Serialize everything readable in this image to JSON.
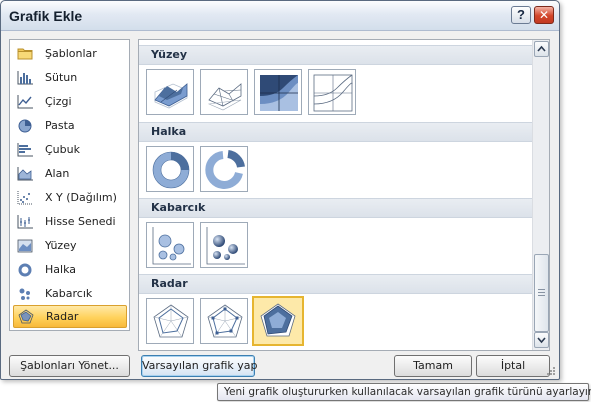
{
  "window": {
    "title": "Grafik Ekle"
  },
  "categories": [
    {
      "label": "Şablonlar",
      "icon": "folder-icon"
    },
    {
      "label": "Sütun",
      "icon": "column-chart-icon"
    },
    {
      "label": "Çizgi",
      "icon": "line-chart-icon"
    },
    {
      "label": "Pasta",
      "icon": "pie-chart-icon"
    },
    {
      "label": "Çubuk",
      "icon": "bar-chart-icon"
    },
    {
      "label": "Alan",
      "icon": "area-chart-icon"
    },
    {
      "label": "X Y (Dağılım)",
      "icon": "scatter-chart-icon"
    },
    {
      "label": "Hisse Senedi",
      "icon": "stock-chart-icon"
    },
    {
      "label": "Yüzey",
      "icon": "surface-chart-icon"
    },
    {
      "label": "Halka",
      "icon": "doughnut-chart-icon"
    },
    {
      "label": "Kabarcık",
      "icon": "bubble-chart-icon"
    },
    {
      "label": "Radar",
      "icon": "radar-chart-icon"
    }
  ],
  "selected_category": "Radar",
  "sections": [
    {
      "title": "Yüzey",
      "thumbs": [
        "3d-surface-icon",
        "wireframe-3d-surface-icon",
        "contour-icon",
        "wireframe-contour-icon"
      ]
    },
    {
      "title": "Halka",
      "thumbs": [
        "doughnut-icon",
        "exploded-doughnut-icon"
      ]
    },
    {
      "title": "Kabarcık",
      "thumbs": [
        "bubble-icon",
        "3d-bubble-icon"
      ]
    },
    {
      "title": "Radar",
      "thumbs": [
        "radar-icon",
        "radar-with-markers-icon",
        "filled-radar-icon"
      ]
    }
  ],
  "selected_thumb": "filled-radar-icon",
  "buttons": {
    "manage_templates": "Şablonları Yönet...",
    "set_default": "Varsayılan grafik yap",
    "ok": "Tamam",
    "cancel": "İptal"
  },
  "title_buttons": {
    "help": "?",
    "close": "✕"
  },
  "tooltip": "Yeni grafik oluştururken kullanılacak varsayılan grafik türünü ayarlayın.",
  "colors": {
    "accent": "#ffd25c",
    "thumb_fill": "#7a9ccf",
    "thumb_dark": "#3e5f93",
    "close_red": "#d2452a"
  }
}
